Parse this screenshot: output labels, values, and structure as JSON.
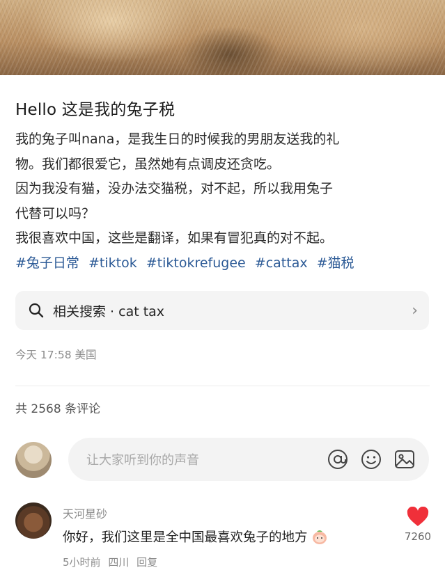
{
  "post": {
    "title": "Hello 这是我的兔子税",
    "lines": [
      "我的兔子叫nana，是我生日的时候我的男朋友送我的礼",
      "物。我们都很爱它，虽然她有点调皮还贪吃。",
      "因为我没有猫，没办法交猫税，对不起，所以我用兔子",
      "代替可以吗？",
      "我很喜欢中国，这些是翻译，如果有冒犯真的对不起。"
    ],
    "tags": [
      "#兔子日常",
      "#tiktok",
      "#tiktokrefugee",
      "#cattax",
      "#猫税"
    ]
  },
  "related_search": {
    "label": "相关搜索 · cat tax",
    "chevron": "›",
    "icon": "search-icon"
  },
  "post_meta": "今天 17:58 美国",
  "comments_count": "共 2568 条评论",
  "comment_input": {
    "placeholder": "让大家听到你的声音",
    "icons": [
      "mention-icon",
      "emoji-icon",
      "image-icon"
    ]
  },
  "comments": [
    {
      "user": "天河星砂",
      "text": "你好，我们这里是全中国最喜欢兔子的地方",
      "time": "5小时前",
      "location": "四川",
      "reply": "回复",
      "likes": "7260",
      "emoji": "peach-emoji"
    }
  ],
  "colors": {
    "tag": "#2c5a96",
    "like": "#f0303a",
    "muted": "#8b8b8b"
  }
}
